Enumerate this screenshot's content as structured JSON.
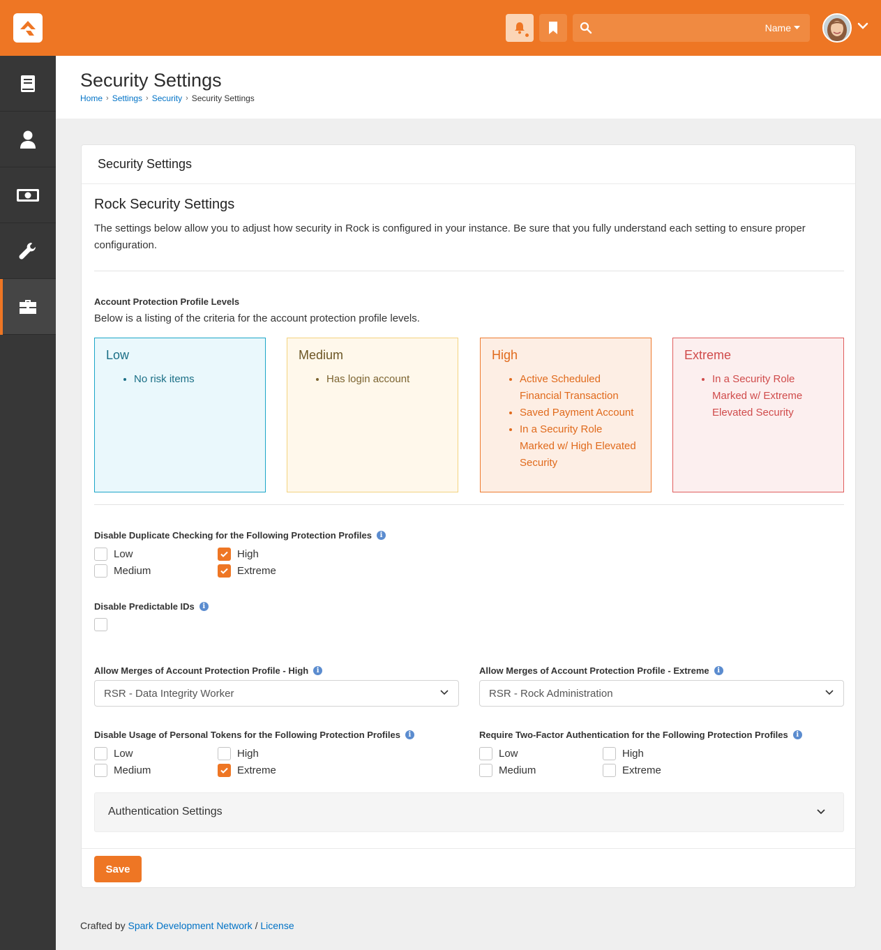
{
  "topbar": {
    "search_placeholder": "",
    "search_scope": "Name"
  },
  "page": {
    "title": "Security Settings",
    "breadcrumb": [
      "Home",
      "Settings",
      "Security",
      "Security Settings"
    ]
  },
  "panel": {
    "heading": "Security Settings",
    "rock_title": "Rock Security Settings",
    "description": "The settings below allow you to adjust how security in Rock is configured in your instance. Be sure that you fully understand each setting to ensure proper configuration.",
    "profiles_label": "Account Protection Profile Levels",
    "profiles_desc": "Below is a listing of the criteria for the account protection profile levels.",
    "levels": [
      {
        "name": "Low",
        "items": [
          "No risk items"
        ]
      },
      {
        "name": "Medium",
        "items": [
          "Has login account"
        ]
      },
      {
        "name": "High",
        "items": [
          "Active Scheduled Financial Transaction",
          "Saved Payment Account",
          "In a Security Role Marked w/ High Elevated Security"
        ]
      },
      {
        "name": "Extreme",
        "items": [
          "In a Security Role Marked w/ Extreme Elevated Security"
        ]
      }
    ],
    "dup_check": {
      "label": "Disable Duplicate Checking for the Following Protection Profiles",
      "options": [
        "Low",
        "High",
        "Medium",
        "Extreme"
      ],
      "checked": [
        false,
        true,
        false,
        true
      ]
    },
    "predictable_ids": {
      "label": "Disable Predictable IDs",
      "checked": false
    },
    "merge_high": {
      "label": "Allow Merges of Account Protection Profile - High",
      "value": "RSR - Data Integrity Worker"
    },
    "merge_extreme": {
      "label": "Allow Merges of Account Protection Profile - Extreme",
      "value": "RSR - Rock Administration"
    },
    "personal_tokens": {
      "label": "Disable Usage of Personal Tokens for the Following Protection Profiles",
      "options": [
        "Low",
        "High",
        "Medium",
        "Extreme"
      ],
      "checked": [
        false,
        false,
        false,
        true
      ]
    },
    "two_factor": {
      "label": "Require Two-Factor Authentication for the Following Protection Profiles",
      "options": [
        "Low",
        "High",
        "Medium",
        "Extreme"
      ],
      "checked": [
        false,
        false,
        false,
        false
      ]
    },
    "auth_settings": "Authentication Settings",
    "save": "Save"
  },
  "footer": {
    "prefix": "Crafted by",
    "org": "Spark Development Network",
    "sep": "/",
    "license": "License"
  },
  "colors": {
    "brand": "#ee7624",
    "sidebar": "#373737",
    "link": "#0072c6"
  }
}
